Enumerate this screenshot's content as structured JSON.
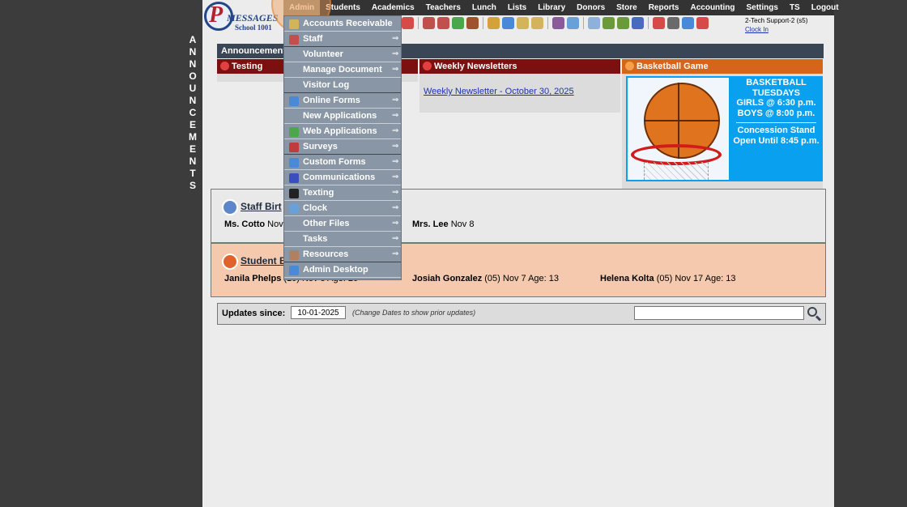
{
  "logo": {
    "letter": "P",
    "brand": "MESSAGES",
    "school": "School 1001"
  },
  "nav": {
    "items": [
      "Admin",
      "Students",
      "Academics",
      "Teachers",
      "Lunch",
      "Lists",
      "Library",
      "Donors",
      "Store",
      "Reports",
      "Accounting",
      "Settings",
      "TS",
      "Logout"
    ],
    "active": "Admin"
  },
  "user": {
    "name": "2-Tech Support-2 (s5)",
    "clock": "Clock In"
  },
  "vertical_label": [
    "A",
    "N",
    "N",
    "O",
    "U",
    "N",
    "C",
    "E",
    "M",
    "E",
    "N",
    "T",
    "S"
  ],
  "announcements": {
    "header": "Announcements",
    "cards": [
      {
        "title": "Testing"
      },
      {
        "title": "Weekly Newsletters",
        "link": "Weekly Newsletter - October 30, 2025"
      },
      {
        "title": "Basketball Game"
      }
    ],
    "poster": {
      "lines": [
        "BASKETBALL",
        "TUESDAYS",
        "GIRLS @ 6:30 p.m.",
        "BOYS  @ 8:00 p.m."
      ],
      "lines2": [
        "Concession Stand",
        "Open Until 8:45 p.m."
      ]
    }
  },
  "staff_birthdays": {
    "title": "Staff Birt",
    "entries": [
      {
        "name": "Ms. Cotto",
        "detail": "Nov"
      },
      {
        "name": "Mrs. Lee",
        "detail": "Nov 8"
      }
    ]
  },
  "student_birthdays": {
    "title": "Student B",
    "entries": [
      {
        "name": "Janila Phelps",
        "detail": "(10) Nov 5 Age: 20"
      },
      {
        "name": "Josiah Gonzalez",
        "detail": "(05) Nov 7 Age: 13"
      },
      {
        "name": "Helena Kolta",
        "detail": "(05) Nov 17 Age: 13"
      }
    ]
  },
  "updates": {
    "label": "Updates since:",
    "date": "10-01-2025",
    "hint": "(Change Dates to show prior updates)",
    "search_value": ""
  },
  "admin_menu": [
    {
      "label": "Accounts Receivable",
      "icon": "accounts-receivable-icon",
      "color": "#d4b45a",
      "arrow": false
    },
    {
      "label": "Staff",
      "icon": "staff-icon",
      "color": "#c0504d",
      "arrow": true
    },
    {
      "label": "Volunteer",
      "icon": "",
      "arrow": true
    },
    {
      "label": "Manage Document",
      "icon": "",
      "arrow": true
    },
    {
      "label": "Visitor Log",
      "icon": "",
      "arrow": false
    },
    {
      "label": "Online Forms",
      "icon": "online-forms-icon",
      "color": "#4a89d8",
      "arrow": true
    },
    {
      "label": "New Applications",
      "icon": "",
      "arrow": true
    },
    {
      "label": "Web Applications",
      "icon": "web-applications-icon",
      "color": "#4aa84a",
      "arrow": true
    },
    {
      "label": "Surveys",
      "icon": "surveys-icon",
      "color": "#c03b3b",
      "arrow": true
    },
    {
      "label": "Custom Forms",
      "icon": "custom-forms-icon",
      "color": "#4a89d8",
      "arrow": true
    },
    {
      "label": "Communications",
      "icon": "communications-icon",
      "color": "#3a4ec0",
      "arrow": true
    },
    {
      "label": "Texting",
      "icon": "texting-icon",
      "color": "#222222",
      "arrow": true
    },
    {
      "label": "Clock",
      "icon": "clock-icon",
      "color": "#6aa0d8",
      "arrow": true
    },
    {
      "label": "Other Files",
      "icon": "",
      "arrow": true
    },
    {
      "label": "Tasks",
      "icon": "",
      "arrow": true
    },
    {
      "label": "Resources",
      "icon": "resources-icon",
      "color": "#b08060",
      "arrow": true
    },
    {
      "label": "Admin Desktop",
      "icon": "admin-desktop-icon",
      "color": "#4a89d8",
      "arrow": false
    }
  ],
  "arrow_glyph": "⇒",
  "colors": {
    "nav_bg": "#333333",
    "card_header_red": "#7a1010",
    "card_header_orange": "#d6641b",
    "student_section": "#f4c9ad",
    "menu_bg": "#8996a5"
  }
}
